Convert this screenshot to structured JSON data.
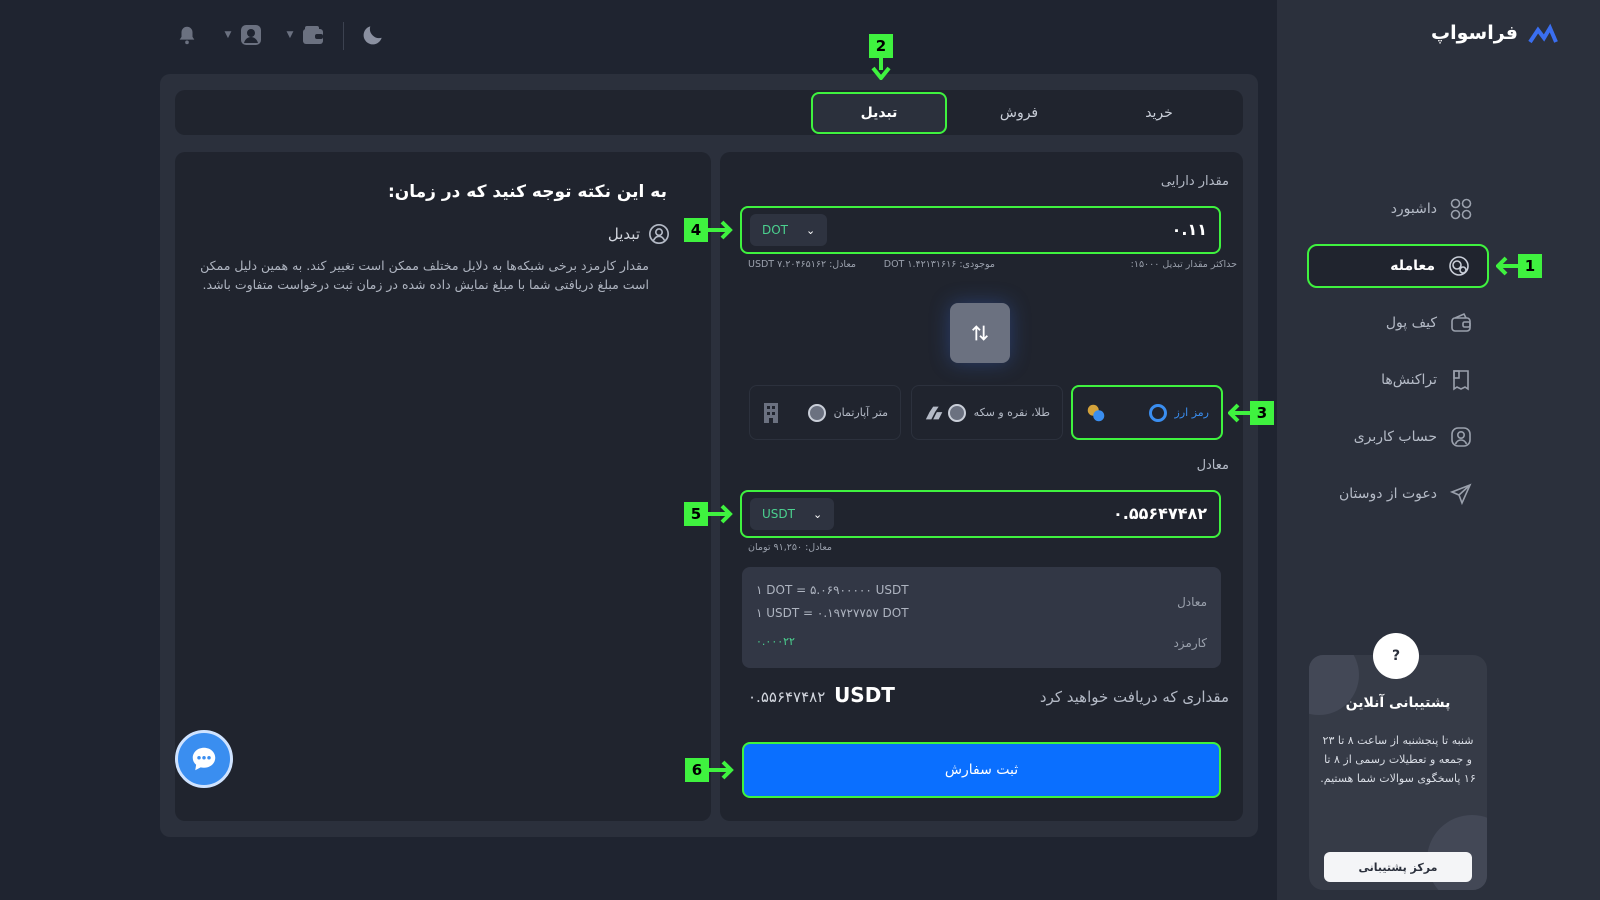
{
  "app": {
    "logo_text": "فراسواپ"
  },
  "sidebar": {
    "items": [
      {
        "label": "داشبورد",
        "icon": "grid-icon"
      },
      {
        "label": "معامله",
        "icon": "trade-icon",
        "active": true
      },
      {
        "label": "کیف پول",
        "icon": "wallet-icon"
      },
      {
        "label": "تراکنش‌ها",
        "icon": "receipt-icon"
      },
      {
        "label": "حساب کاربری",
        "icon": "user-icon"
      },
      {
        "label": "دعوت از دوستان",
        "icon": "send-icon"
      }
    ],
    "support": {
      "question_mark": "?",
      "title": "پشتیبانی آنلاین",
      "text": "شنبه تا پنجشنبه از ساعت ۸ تا ۲۳ و جمعه و تعطیلات رسمی از ۸ تا ۱۶ پاسخگوی سوالات شما هستیم.",
      "button": "مرکز پشتیبانی"
    }
  },
  "markers": [
    "1",
    "2",
    "3",
    "4",
    "5",
    "6"
  ],
  "tabs": [
    "خرید",
    "فروش",
    "تبدیل"
  ],
  "active_tab": "تبدیل",
  "notice": {
    "title": "به این نکته توجه کنید که در زمان:",
    "subtitle": "تبدیل",
    "text": "مقدار کارمزد برخی شبکه‌ها به دلایل مختلف ممکن است تغییر کند. به همین دلیل ممکن است مبلغ دریافتی شما با مبلغ نمایش داده شده در زمان ثبت درخواست متفاوت باشد."
  },
  "convert": {
    "asset_label": "مقدار دارایی",
    "from_value": "۰.۱۱",
    "from_currency": "DOT",
    "max_hint": "حداکثر مقدار تبدیل ۱۵۰۰۰:",
    "balance_hint": "موجودی: DOT ۱.۴۲۱۳۱۶۱۶",
    "balance_equiv_hint": "معادل: USDT ۷.۲۰۴۶۵۱۶۲",
    "options": [
      {
        "label": "رمز ارز",
        "icon": "coins-icon",
        "selected": true
      },
      {
        "label": "طلا، نقره و سکه",
        "icon": "gold-bars-icon",
        "selected": false
      },
      {
        "label": "متر آپارتمان",
        "icon": "building-icon",
        "selected": false
      }
    ],
    "equiv_label": "معادل",
    "to_value": "۰.۵۵۶۴۷۴۸۲",
    "to_currency": "USDT",
    "to_hint": "معادل: ۹۱,۲۵۰ تومان",
    "rate_label": "معادل",
    "rate_line_1": "۱ DOT = ۵.۰۶۹۰۰۰۰۰ USDT",
    "rate_line_2": "۱ USDT = ۰.۱۹۷۲۷۷۵۷ DOT",
    "fee_label": "کارمزد",
    "fee_value": "۰.۰۰۰۲۲",
    "receive_label": "مقداری که دریافت خواهید کرد",
    "receive_amount": "۰.۵۵۶۴۷۴۸۲",
    "receive_currency": "USDT",
    "submit": "ثبت سفارش"
  },
  "colors": {
    "highlight": "#3ff23f",
    "accent_blue": "#0a6fff",
    "positive_green": "#4bd18f"
  }
}
